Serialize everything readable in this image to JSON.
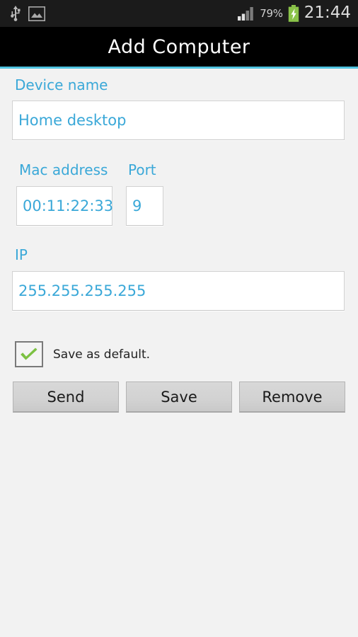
{
  "status_bar": {
    "left_icons": [
      {
        "name": "usb-icon",
        "label": "USB"
      },
      {
        "name": "image-icon",
        "label": "Screenshot captured"
      }
    ],
    "signal_icon": "signal-bars-icon",
    "signal_bars_filled": 2,
    "signal_bars_total": 4,
    "battery_percent": "79%",
    "battery_icon": "battery-charging-icon",
    "clock": "21:44",
    "background_color": "#1b1b1b",
    "battery_color": "#8ac349"
  },
  "title_bar": {
    "title": "Add Computer",
    "background_color": "#000000",
    "accent_color": "#4fc3e0"
  },
  "form": {
    "accent_color": "#3aa8d8",
    "device_name": {
      "label": "Device name",
      "value": "Home desktop",
      "placeholder": "Device name"
    },
    "mac_address": {
      "label": "Mac address",
      "value": "00:11:22:33",
      "placeholder": "Mac address"
    },
    "port": {
      "label": "Port",
      "value": "9",
      "placeholder": "Port"
    },
    "ip": {
      "label": "IP",
      "value": "255.255.255.255",
      "placeholder": "IP"
    },
    "save_as_default": {
      "label": "Save as default.",
      "checked": true,
      "check_color": "#7cc142"
    }
  },
  "buttons": {
    "send": "Send",
    "save": "Save",
    "remove": "Remove"
  }
}
